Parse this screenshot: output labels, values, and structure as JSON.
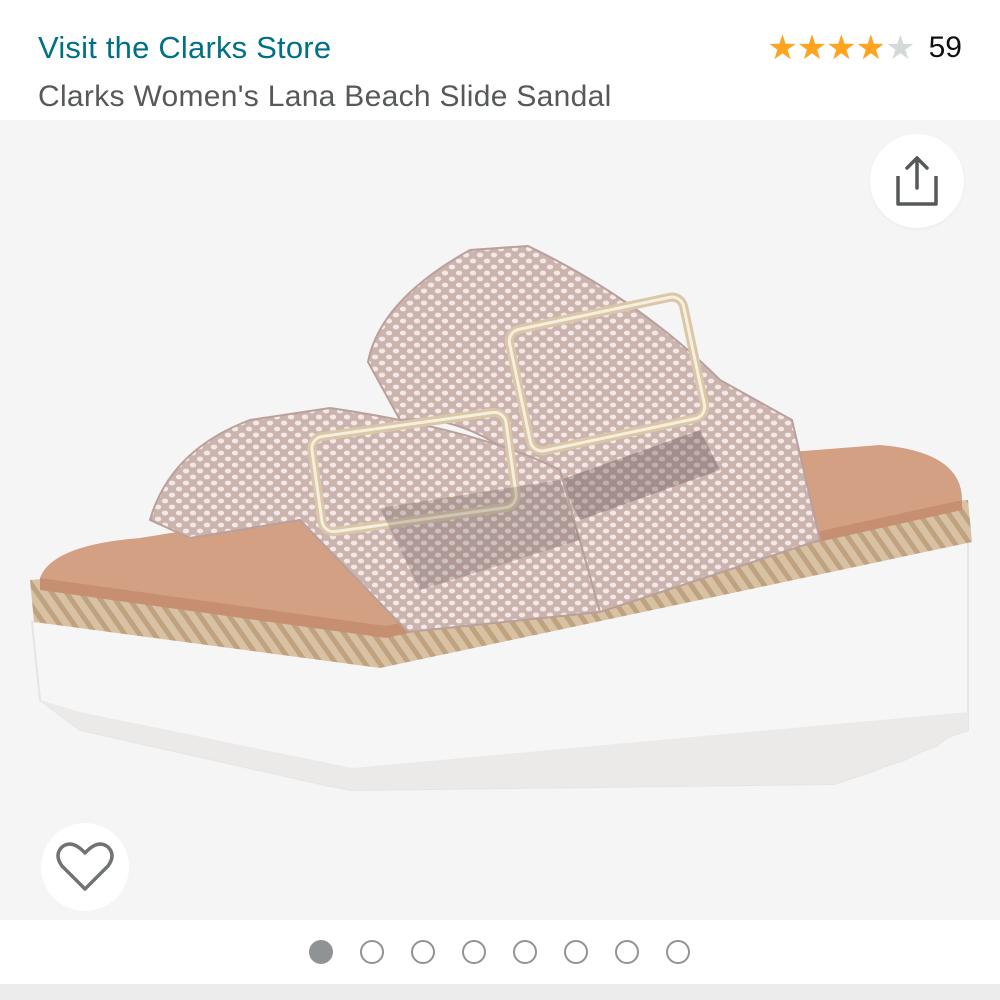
{
  "header": {
    "store_link": "Visit the Clarks Store",
    "product_title": "Clarks Women's Lana Beach Slide Sandal",
    "rating": {
      "stars_glyphs": "★★★★★",
      "value_fraction": 0.78,
      "count": "59",
      "star_color": "#ffa41c"
    }
  },
  "gallery": {
    "image_description": "Clarks Lana Beach slide sandal in pink snake print",
    "share_icon": "share-icon",
    "favorite_icon": "heart-outline-icon",
    "pager": {
      "total": 8,
      "active_index": 0
    }
  },
  "colors": {
    "link": "#007185",
    "title": "#565959",
    "gallery_bg": "#f5f5f5"
  }
}
